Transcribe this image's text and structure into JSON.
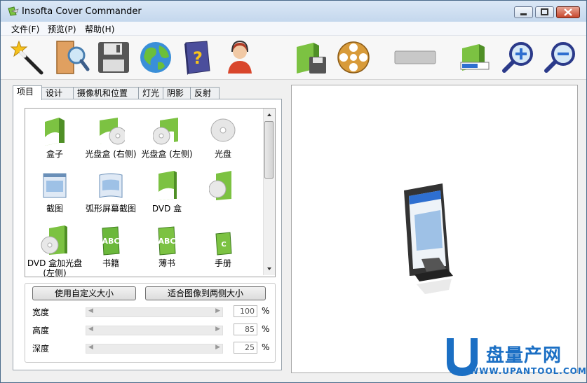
{
  "window": {
    "title": "Insofta Cover Commander",
    "controls": [
      "minimize",
      "maximize",
      "close"
    ]
  },
  "menu": {
    "items": [
      "文件(F)",
      "预览(P)",
      "帮助(H)"
    ]
  },
  "toolbar": {
    "tools": [
      {
        "name": "wizard-icon"
      },
      {
        "name": "open-folder-icon"
      },
      {
        "name": "save-icon"
      },
      {
        "name": "web-globe-icon"
      },
      {
        "name": "help-book-icon"
      },
      {
        "name": "support-agent-icon"
      },
      {
        "name": "save-image-icon"
      },
      {
        "name": "render-video-icon"
      },
      {
        "name": "blank-button-icon"
      },
      {
        "name": "progress-icon"
      },
      {
        "name": "zoom-in-icon"
      },
      {
        "name": "zoom-out-icon"
      }
    ]
  },
  "tabs": [
    "项目",
    "设计",
    "摄像机和位置",
    "灯光",
    "阴影",
    "反射"
  ],
  "active_tab": "项目",
  "gallery": {
    "items": [
      {
        "label": "盒子",
        "icon": "box-icon"
      },
      {
        "label": "光盘盒 (右侧)",
        "icon": "cd-case-right-icon"
      },
      {
        "label": "光盘盒 (左侧)",
        "icon": "cd-case-left-icon"
      },
      {
        "label": "光盘",
        "icon": "disc-icon"
      },
      {
        "label": "截图",
        "icon": "screenshot-icon"
      },
      {
        "label": "弧形屏幕截图",
        "icon": "curved-screenshot-icon"
      },
      {
        "label": "DVD 盒",
        "icon": "dvd-box-icon"
      },
      {
        "label": "",
        "icon": "dvd-disc-box-icon"
      },
      {
        "label": "DVD 盒加光盘 (左侧)",
        "icon": "dvd-box-with-disc-icon"
      },
      {
        "label": "书籍",
        "icon": "book-icon"
      },
      {
        "label": "薄书",
        "icon": "thin-book-icon"
      },
      {
        "label": "手册",
        "icon": "manual-icon"
      }
    ]
  },
  "size_controls": {
    "custom_size_button": "使用自定义大小",
    "fit_image_button": "适合图像到两侧大小",
    "rows": [
      {
        "label": "宽度",
        "value": "100",
        "unit": "%"
      },
      {
        "label": "高度",
        "value": "85",
        "unit": "%"
      },
      {
        "label": "深度",
        "value": "25",
        "unit": "%"
      }
    ]
  },
  "preview": {
    "object": "monitor-preview"
  },
  "watermark": {
    "letter": "U",
    "brand": "盘量产网",
    "url": "WWW.UPANTOOL.COM"
  },
  "colors": {
    "box_green": "#7cc242",
    "accent_blue": "#2e6fd0",
    "watermark_blue": "#1b6fc4"
  }
}
